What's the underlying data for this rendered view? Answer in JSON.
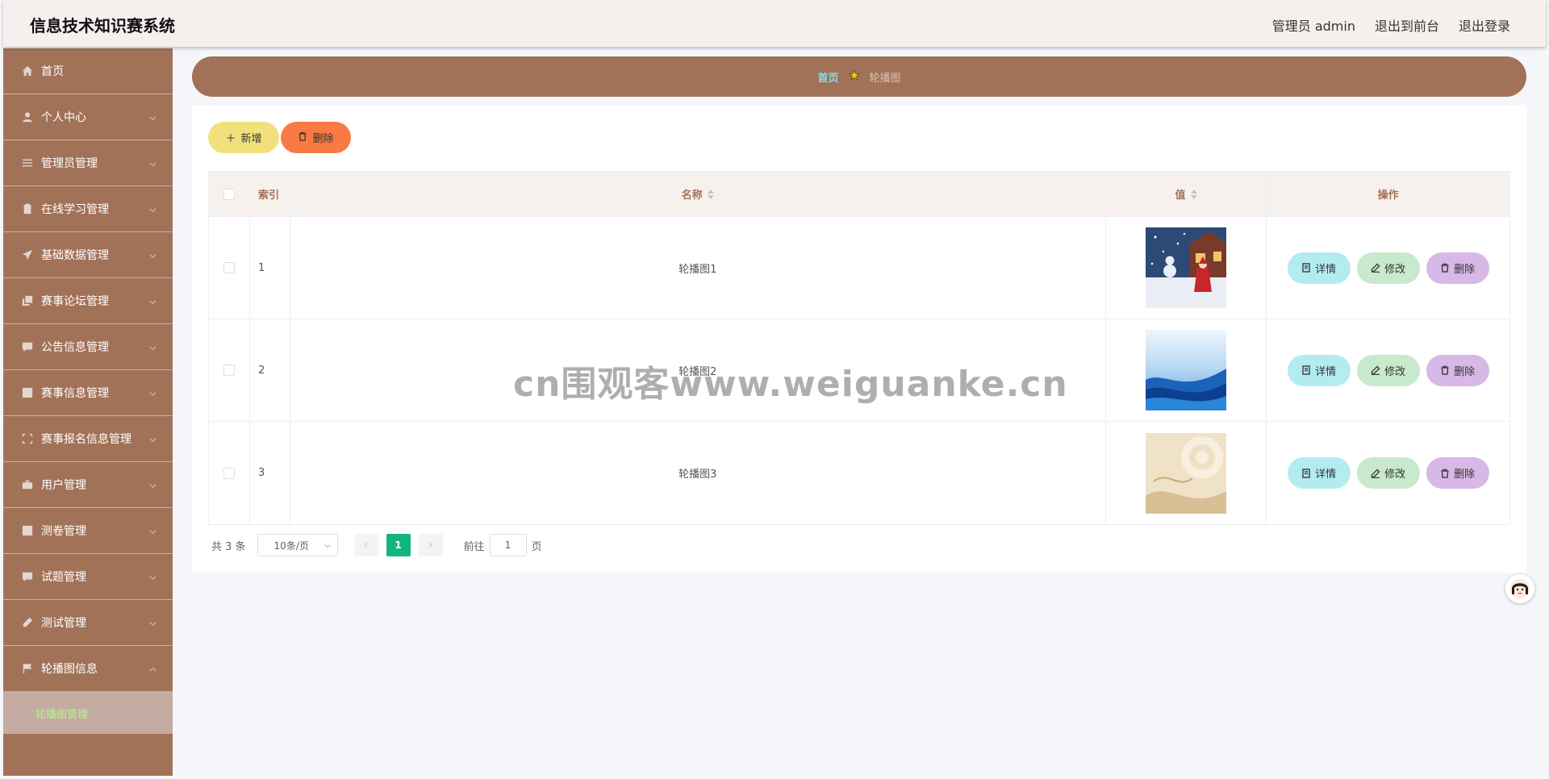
{
  "app": {
    "title": "信息技术知识赛系统"
  },
  "header": {
    "user_label": "管理员 admin",
    "front_label": "退出到前台",
    "logout_label": "退出登录"
  },
  "sidebar": {
    "items": [
      {
        "label": "首页",
        "icon": "home-icon"
      },
      {
        "label": "个人中心",
        "icon": "user-icon"
      },
      {
        "label": "管理员管理",
        "icon": "sliders-icon"
      },
      {
        "label": "在线学习管理",
        "icon": "clipboard-icon"
      },
      {
        "label": "基础数据管理",
        "icon": "send-icon"
      },
      {
        "label": "赛事论坛管理",
        "icon": "copy-icon"
      },
      {
        "label": "公告信息管理",
        "icon": "message-icon"
      },
      {
        "label": "赛事信息管理",
        "icon": "chart-icon"
      },
      {
        "label": "赛事报名信息管理",
        "icon": "frame-icon"
      },
      {
        "label": "用户管理",
        "icon": "briefcase-icon"
      },
      {
        "label": "测卷管理",
        "icon": "checkbox-icon"
      },
      {
        "label": "试题管理",
        "icon": "chat-icon"
      },
      {
        "label": "测试管理",
        "icon": "no-edit-icon"
      },
      {
        "label": "轮播图信息",
        "icon": "flag-icon"
      }
    ],
    "sub_item": {
      "label": "轮播图管理"
    },
    "colors": {
      "bg": "#a27258",
      "active_sub_text": "#b8f28f"
    }
  },
  "breadcrumb": {
    "home": "首页",
    "current": "轮播图"
  },
  "toolbar": {
    "add_label": "新增",
    "delete_label": "删除"
  },
  "table": {
    "headers": {
      "index": "索引",
      "name": "名称",
      "value": "值",
      "actions": "操作"
    },
    "rows": [
      {
        "index": "1",
        "name": "轮播图1",
        "image": "santa-snow-thumbnail"
      },
      {
        "index": "2",
        "name": "轮播图2",
        "image": "blue-wave-thumbnail"
      },
      {
        "index": "3",
        "name": "轮播图3",
        "image": "cream-rose-thumbnail"
      }
    ],
    "action_labels": {
      "detail": "详情",
      "edit": "修改",
      "remove": "删除"
    }
  },
  "pagination": {
    "total_text": "共 3 条",
    "page_size": "10条/页",
    "current_page": "1",
    "goto_prefix": "前往",
    "goto_value": "1",
    "goto_suffix": "页"
  },
  "watermark": "cn围观客www.weiguanke.cn"
}
